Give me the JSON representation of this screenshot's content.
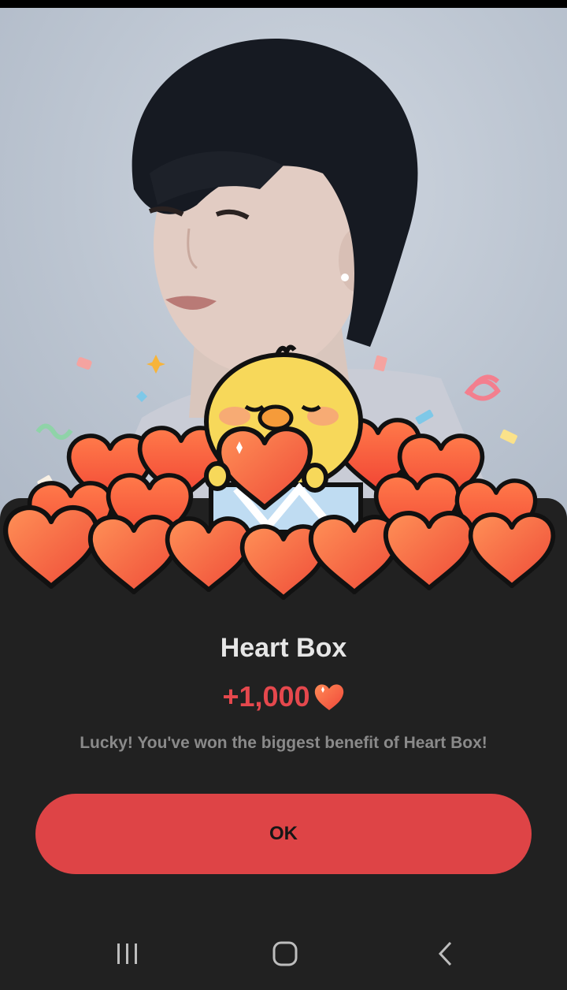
{
  "dialog": {
    "title": "Heart Box",
    "reward_amount": "+1,000",
    "reward_icon": "heart-icon",
    "message": "Lucky! You've won the biggest benefit of Heart Box!",
    "ok_label": "OK"
  },
  "background": {
    "image": "portrait-photo"
  },
  "illustration": {
    "subject": "chick-holding-heart-in-heart-pile"
  },
  "nav_bar": {
    "icons": [
      "recent-apps-icon",
      "home-icon",
      "back-icon"
    ]
  },
  "colors": {
    "accent": "#de4446",
    "reward_text": "#e5484d",
    "sheet_background": "#212121",
    "heart_fill": "#f25a3b",
    "chick_yellow": "#f7d85a"
  }
}
